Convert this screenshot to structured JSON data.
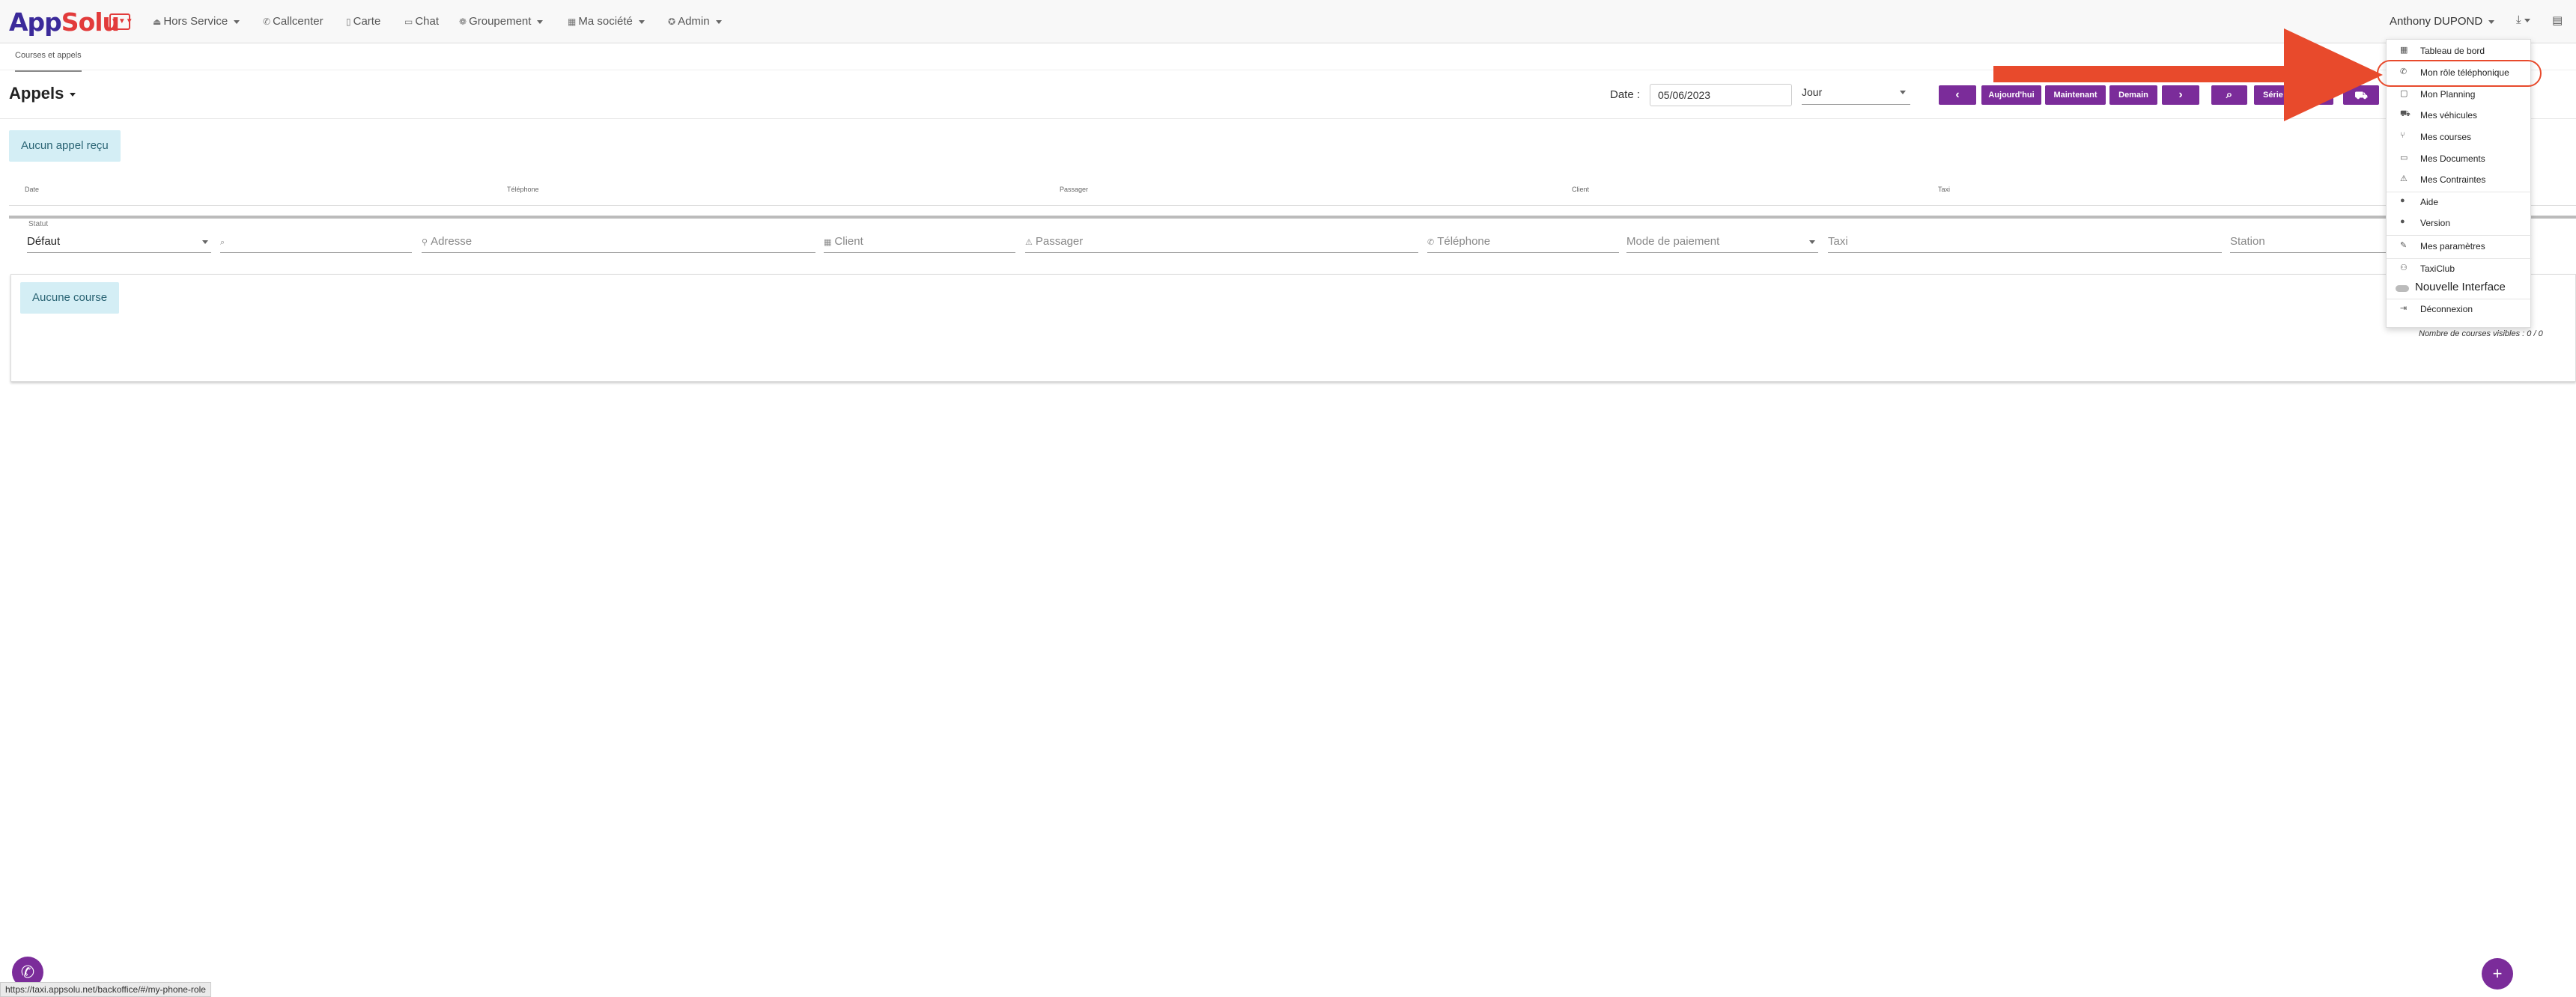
{
  "app": {
    "logo_a": "App",
    "logo_b": "Solu",
    "logo_box": "▼▼▼"
  },
  "nav": [
    {
      "icon": "⏏",
      "label": "Hors Service"
    },
    {
      "icon": "✆",
      "label": "Callcenter"
    },
    {
      "icon": "▯",
      "label": "Carte"
    },
    {
      "icon": "▭",
      "label": "Chat"
    },
    {
      "icon": "❁",
      "label": "Groupement"
    },
    {
      "icon": "▦",
      "label": "Ma société"
    },
    {
      "icon": "✪",
      "label": "Admin"
    }
  ],
  "user": {
    "name": "Anthony DUPOND"
  },
  "topright": {
    "download_icon": "⤓",
    "card_icon": "▤"
  },
  "tab": {
    "label": "Courses et appels"
  },
  "page": {
    "title": "Appels"
  },
  "toolbar": {
    "date_label": "Date :",
    "date_value": "05/06/2023",
    "period_value": "Jour",
    "prev": "‹",
    "today": "Aujourd'hui",
    "now": "Maintenant",
    "tomorrow": "Demain",
    "next": "›",
    "search": "⌕",
    "series": "Série",
    "car": "⛟"
  },
  "calls": {
    "empty": "Aucun appel reçu",
    "columns": [
      "Date",
      "Téléphone",
      "Passager",
      "Client",
      "Taxi"
    ]
  },
  "filters": {
    "statut_label": "Statut",
    "statut_value": "Défaut",
    "search_icon": "⌕",
    "adresse": "Adresse",
    "client": "Client",
    "passager": "Passager",
    "telephone": "Téléphone",
    "mode_paiement": "Mode de paiement",
    "taxi": "Taxi",
    "station": "Station"
  },
  "courses": {
    "empty": "Aucune course",
    "visible_count": "Nombre de courses visibles : 0 / 0"
  },
  "menu": {
    "items": [
      {
        "icon": "▦",
        "label": "Tableau de bord"
      },
      {
        "icon": "✆",
        "label": "Mon rôle téléphonique"
      },
      {
        "icon": "▢",
        "label": "Mon Planning"
      },
      {
        "icon": "⛟",
        "label": "Mes véhicules"
      },
      {
        "icon": "⑂",
        "label": "Mes courses"
      },
      {
        "icon": "▭",
        "label": "Mes Documents"
      },
      {
        "icon": "⚠",
        "label": "Mes Contraintes"
      },
      {
        "icon": "●",
        "label": "Aide"
      },
      {
        "icon": "●",
        "label": "Version"
      },
      {
        "icon": "✎",
        "label": "Mes paramètres"
      },
      {
        "icon": "⚇",
        "label": "TaxiClub"
      },
      {
        "icon": "",
        "label": "Nouvelle Interface"
      },
      {
        "icon": "⇥",
        "label": "Déconnexion"
      }
    ]
  },
  "fabs": {
    "phone": "✆",
    "add": "+"
  },
  "statusbar": {
    "url": "https://taxi.appsolu.net/backoffice/#/my-phone-role"
  },
  "colors": {
    "accent": "#7b2c9a",
    "annotation": "#e84a2c",
    "empty_bg": "#d4eef5"
  }
}
